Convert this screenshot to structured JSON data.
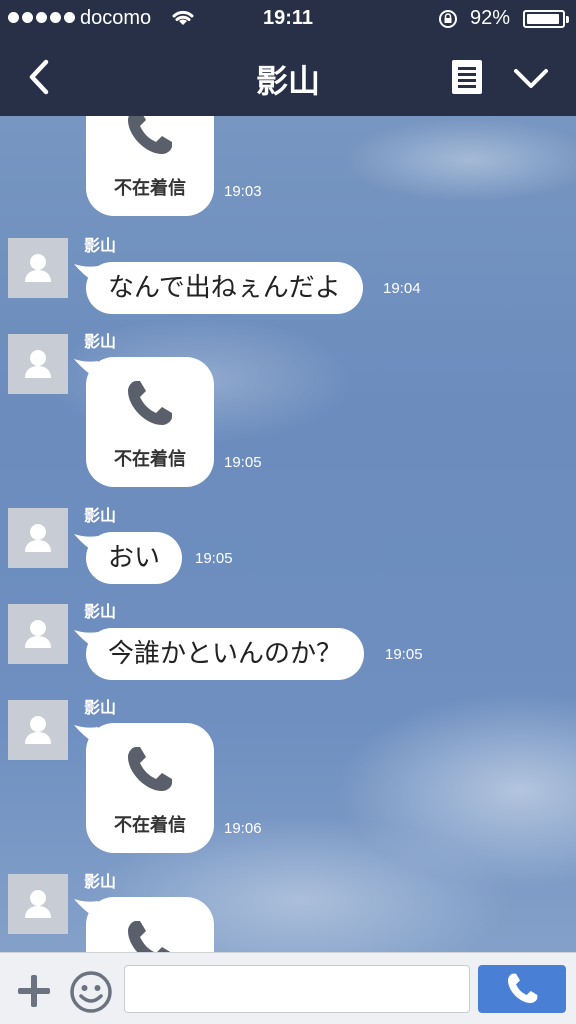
{
  "status_bar": {
    "carrier": "docomo",
    "time": "19:11",
    "battery_percent": "92%",
    "battery_level": 0.92,
    "signal_dots": 5
  },
  "nav": {
    "title": "影山",
    "back_icon": "chevron-left-icon",
    "notes_icon": "note-list-icon",
    "expand_icon": "chevron-down-icon"
  },
  "messages": [
    {
      "type": "missed_call",
      "sender": "",
      "label": "不在着信",
      "time": "19:03"
    },
    {
      "type": "text",
      "sender": "影山",
      "text": "なんで出ねぇんだよ",
      "time": "19:04"
    },
    {
      "type": "missed_call",
      "sender": "影山",
      "label": "不在着信",
      "time": "19:05"
    },
    {
      "type": "text",
      "sender": "影山",
      "text": "おい",
      "time": "19:05"
    },
    {
      "type": "text",
      "sender": "影山",
      "text": "今誰かといんのか？",
      "time": "19:05"
    },
    {
      "type": "missed_call",
      "sender": "影山",
      "label": "不在着信",
      "time": "19:06"
    },
    {
      "type": "missed_call",
      "sender": "影山",
      "label": "",
      "time": ""
    }
  ],
  "input_bar": {
    "placeholder": "",
    "value": "",
    "plus_icon": "plus-icon",
    "emoji_icon": "smiley-icon",
    "call_icon": "phone-icon"
  },
  "colors": {
    "header": "#273046",
    "call_button": "#4a7fd6",
    "bubble": "#ffffff"
  }
}
